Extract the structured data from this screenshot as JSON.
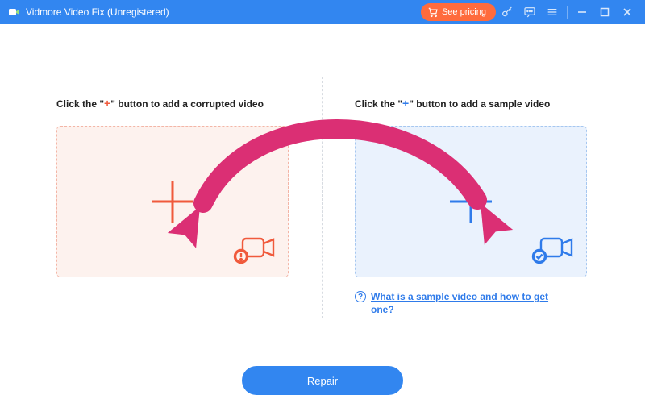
{
  "titlebar": {
    "title": "Vidmore Video Fix (Unregistered)",
    "see_pricing_label": "See pricing"
  },
  "left": {
    "hint_pre": "Click the \"",
    "hint_plus": "+",
    "hint_post": "\" button to add a corrupted video"
  },
  "right": {
    "hint_pre": "Click the \"",
    "hint_plus": "+",
    "hint_post": "\" button to add a sample video"
  },
  "help_link": "What is a sample video and how to get one?",
  "repair_label": "Repair",
  "colors": {
    "accent": "#3286f0",
    "left_accent": "#f05a3c",
    "right_accent": "#2f7bea",
    "arrow": "#db2f74"
  }
}
